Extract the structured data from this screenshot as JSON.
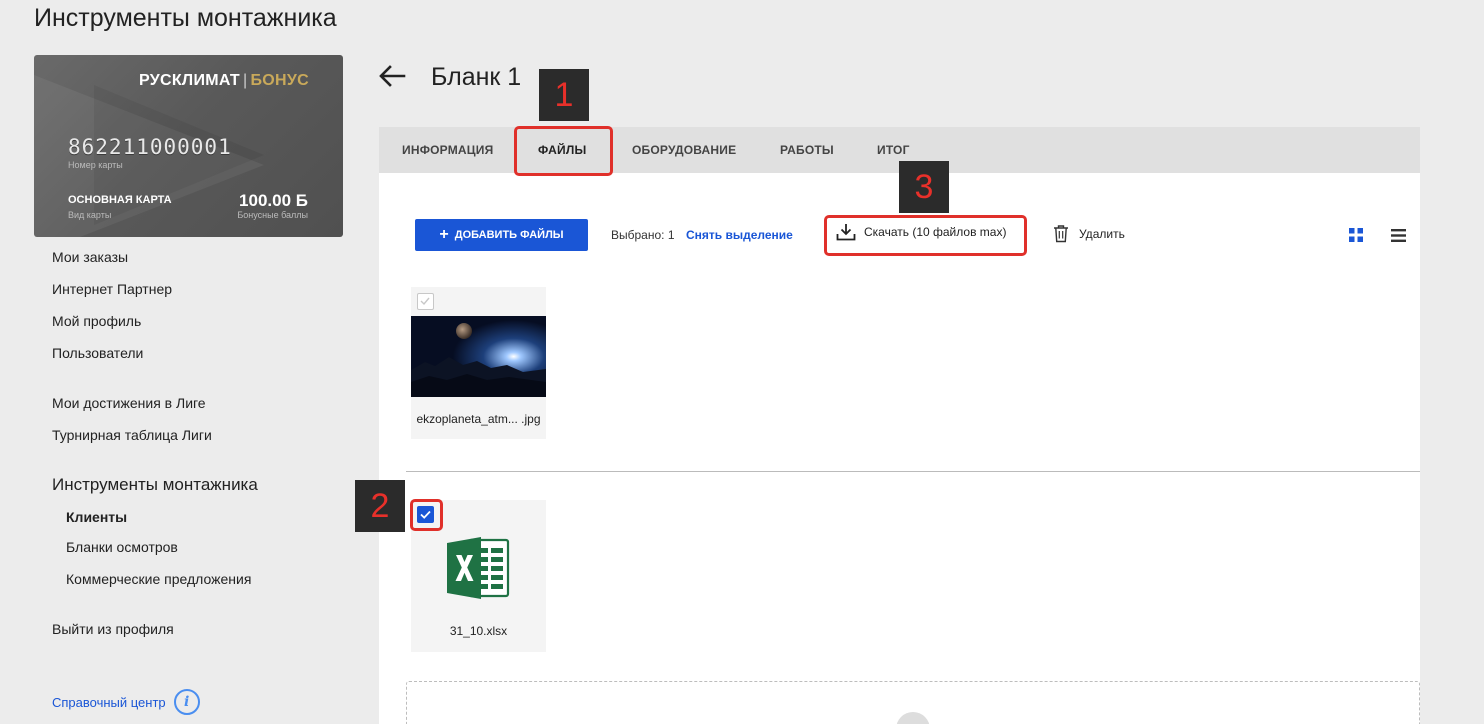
{
  "page": {
    "title": "Инструменты монтажника"
  },
  "card": {
    "brand": "РУСКЛИМАТ",
    "brand_sep": "|",
    "brand_bonus": "БОНУС",
    "number": "862211000001",
    "number_label": "Номер карты",
    "type": "ОСНОВНАЯ КАРТА",
    "type_label": "Вид карты",
    "points": "100.00 Б",
    "points_label": "Бонусные баллы"
  },
  "sidebar": {
    "items": [
      "Мои заказы",
      "Интернет Партнер",
      "Мой профиль",
      "Пользователи"
    ],
    "league": [
      "Мои достижения в Лиге",
      "Турнирная таблица Лиги"
    ],
    "section_title": "Инструменты монтажника",
    "sub_items": [
      "Клиенты",
      "Бланки осмотров",
      "Коммерческие предложения"
    ],
    "logout": "Выйти из профиля",
    "help": "Справочный центр"
  },
  "header": {
    "title": "Бланк 1",
    "back_icon": "arrow-left-icon"
  },
  "tabs": [
    "ИНФОРМАЦИЯ",
    "ФАЙЛЫ",
    "ОБОРУДОВАНИЕ",
    "РАБОТЫ",
    "ИТОГ"
  ],
  "active_tab": "ФАЙЛЫ",
  "toolbar": {
    "add_files": "ДОБАВИТЬ ФАЙЛЫ",
    "selected": "Выбрано: 1",
    "deselect": "Снять выделение",
    "download": "Скачать (10 файлов max)",
    "delete": "Удалить"
  },
  "files": [
    {
      "name": "ekzoplaneta_atm... .jpg",
      "checked": false
    },
    {
      "name": "31_10.xlsx",
      "checked": true
    }
  ],
  "annotations": [
    "1",
    "2",
    "3"
  ],
  "colors": {
    "accent": "#1a56d6",
    "annotation_red": "#e0302a",
    "excel_green": "#1f7244"
  }
}
